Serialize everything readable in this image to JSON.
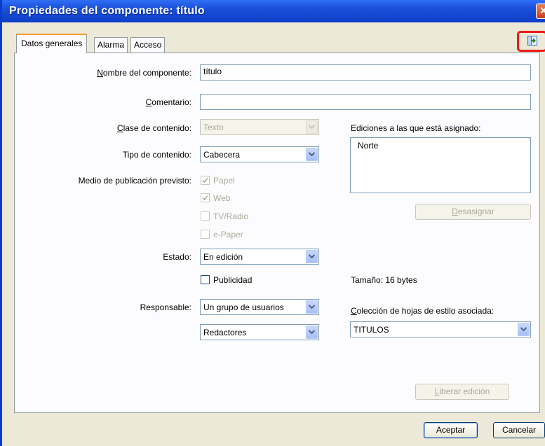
{
  "window": {
    "title": "Propiedades del componente:  título",
    "close_symbol": "✕"
  },
  "tabs": [
    {
      "label": "Datos generales",
      "active": true
    },
    {
      "label": "Alarma",
      "active": false
    },
    {
      "label": "Acceso",
      "active": false
    }
  ],
  "toolbar": {
    "export_icon": "export-icon"
  },
  "form": {
    "nombre": {
      "label_u": "N",
      "label_rest": "ombre del componente:",
      "value": "título"
    },
    "comentario": {
      "label_u": "C",
      "label_rest": "omentario:",
      "value": ""
    },
    "clase": {
      "label_u": "C",
      "label_rest": "lase de contenido:",
      "value": "Texto"
    },
    "tipo": {
      "label": "Tipo de contenido:",
      "value": "Cabecera"
    },
    "medio": {
      "label": "Medio de publicación previsto:",
      "options": [
        {
          "label": "Papel",
          "checked": true
        },
        {
          "label": "Web",
          "checked": true
        },
        {
          "label": "TV/Radio",
          "checked": false
        },
        {
          "label": "e-Paper",
          "checked": false
        }
      ]
    },
    "estado": {
      "label": "Estado:",
      "value": "En edición"
    },
    "publicidad": {
      "label": "Publicidad",
      "checked": false
    },
    "responsable": {
      "label": "Responsable:",
      "value1": "Un grupo de usuarios",
      "value2": "Redactores"
    }
  },
  "ediciones": {
    "label": "Ediciones a las que está asignado:",
    "items": [
      "Norte"
    ],
    "desasignar_u": "D",
    "desasignar_rest": "esasignar"
  },
  "tamano": {
    "text": "Tamaño: 16  bytes"
  },
  "coleccion": {
    "label_u": "C",
    "label_rest": "olección de hojas de estilo asociada:",
    "value": "TITULOS"
  },
  "liberar": {
    "u": "L",
    "rest": "iberar edición"
  },
  "footer": {
    "aceptar": "Aceptar",
    "cancelar": "Cancelar"
  },
  "colors": {
    "titlebar": "#0e3ec8",
    "highlight": "#ee1b1b",
    "tab_accent": "#f0a030"
  }
}
